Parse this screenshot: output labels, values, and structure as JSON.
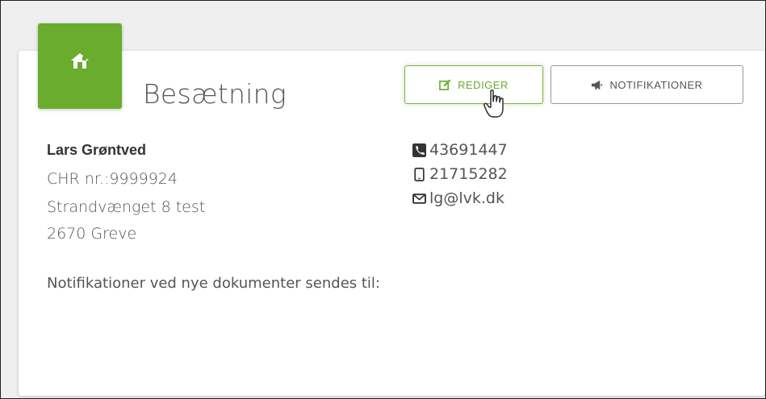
{
  "page": {
    "title": "Besætning"
  },
  "icons": {
    "badge": "house-icon",
    "edit": "edit-icon",
    "notifications": "megaphone-icon",
    "phone": "phone-icon",
    "mobile": "mobile-icon",
    "email": "envelope-icon",
    "cursor": "hand-pointer-cursor"
  },
  "colors": {
    "accent": "#6aac2e",
    "text": "#555555",
    "background": "#efefef"
  },
  "actions": {
    "edit_label": "REDIGER",
    "notifications_label": "NOTIFIKATIONER"
  },
  "owner": {
    "name": "Lars Grøntved",
    "chr": "CHR nr.:9999924",
    "street": "Strandvænget 8 test",
    "city": "2670 Greve"
  },
  "contact": {
    "phone": "43691447",
    "mobile": "21715282",
    "email": "lg@lvk.dk"
  },
  "notice": "Notifikationer ved nye dokumenter sendes til:"
}
